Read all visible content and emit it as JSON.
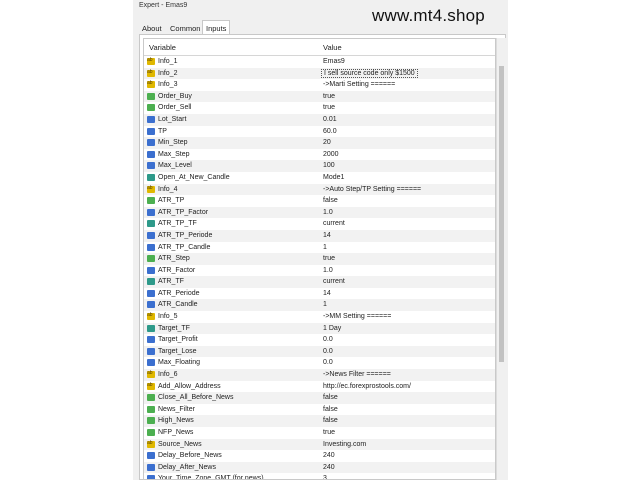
{
  "window": {
    "title": "Expert - Emas9"
  },
  "watermark": "www.mt4.shop",
  "tabs": [
    {
      "label": "About",
      "active": false
    },
    {
      "label": "Common",
      "active": false
    },
    {
      "label": "Inputs",
      "active": true
    }
  ],
  "columns": {
    "variable": "Variable",
    "value": "Value"
  },
  "rows": [
    {
      "name": "Info_1",
      "value": "Emas9",
      "icon": "string-icon"
    },
    {
      "name": "Info_2",
      "value": "I sell source code only $1500",
      "icon": "string-icon"
    },
    {
      "name": "Info_3",
      "value": "->Marti Setting ======",
      "icon": "string-icon"
    },
    {
      "name": "Order_Buy",
      "value": "true",
      "icon": "bool-icon"
    },
    {
      "name": "Order_Sell",
      "value": "true",
      "icon": "bool-icon"
    },
    {
      "name": "Lot_Start",
      "value": "0.01",
      "icon": "number-icon"
    },
    {
      "name": "TP",
      "value": "60.0",
      "icon": "number-icon"
    },
    {
      "name": "Min_Step",
      "value": "20",
      "icon": "number-icon"
    },
    {
      "name": "Max_Step",
      "value": "2000",
      "icon": "number-icon"
    },
    {
      "name": "Max_Level",
      "value": "100",
      "icon": "number-icon"
    },
    {
      "name": "Open_At_New_Candle",
      "value": "Mode1",
      "icon": "enum-icon"
    },
    {
      "name": "Info_4",
      "value": "->Auto Step/TP Setting ======",
      "icon": "string-icon"
    },
    {
      "name": "ATR_TP",
      "value": "false",
      "icon": "bool-icon"
    },
    {
      "name": "ATR_TP_Factor",
      "value": "1.0",
      "icon": "number-icon"
    },
    {
      "name": "ATR_TP_TF",
      "value": "current",
      "icon": "timeframe-icon"
    },
    {
      "name": "ATR_TP_Periode",
      "value": "14",
      "icon": "number-icon"
    },
    {
      "name": "ATR_TP_Candle",
      "value": "1",
      "icon": "number-icon"
    },
    {
      "name": "ATR_Step",
      "value": "true",
      "icon": "bool-icon"
    },
    {
      "name": "ATR_Factor",
      "value": "1.0",
      "icon": "number-icon"
    },
    {
      "name": "ATR_TF",
      "value": "current",
      "icon": "timeframe-icon"
    },
    {
      "name": "ATR_Periode",
      "value": "14",
      "icon": "number-icon"
    },
    {
      "name": "ATR_Candle",
      "value": "1",
      "icon": "number-icon"
    },
    {
      "name": "Info_5",
      "value": "->MM Setting ======",
      "icon": "string-icon"
    },
    {
      "name": "Target_TF",
      "value": "1 Day",
      "icon": "timeframe-icon"
    },
    {
      "name": "Target_Profit",
      "value": "0.0",
      "icon": "number-icon"
    },
    {
      "name": "Target_Lose",
      "value": "0.0",
      "icon": "number-icon"
    },
    {
      "name": "Max_Floating",
      "value": "0.0",
      "icon": "number-icon"
    },
    {
      "name": "Info_6",
      "value": "->News Filter ======",
      "icon": "string-icon"
    },
    {
      "name": "Add_Allow_Address",
      "value": "http://ec.forexprostools.com/",
      "icon": "string-icon"
    },
    {
      "name": "Close_All_Before_News",
      "value": "false",
      "icon": "bool-icon"
    },
    {
      "name": "News_Filter",
      "value": "false",
      "icon": "bool-icon"
    },
    {
      "name": "High_News",
      "value": "false",
      "icon": "bool-icon"
    },
    {
      "name": "NFP_News",
      "value": "true",
      "icon": "bool-icon"
    },
    {
      "name": "Source_News",
      "value": "Investing.com",
      "icon": "string-icon"
    },
    {
      "name": "Delay_Before_News",
      "value": "240",
      "icon": "number-icon"
    },
    {
      "name": "Delay_After_News",
      "value": "240",
      "icon": "number-icon"
    },
    {
      "name": "Your_Time_Zone_GMT (for news)",
      "value": "3",
      "icon": "number-icon"
    }
  ]
}
